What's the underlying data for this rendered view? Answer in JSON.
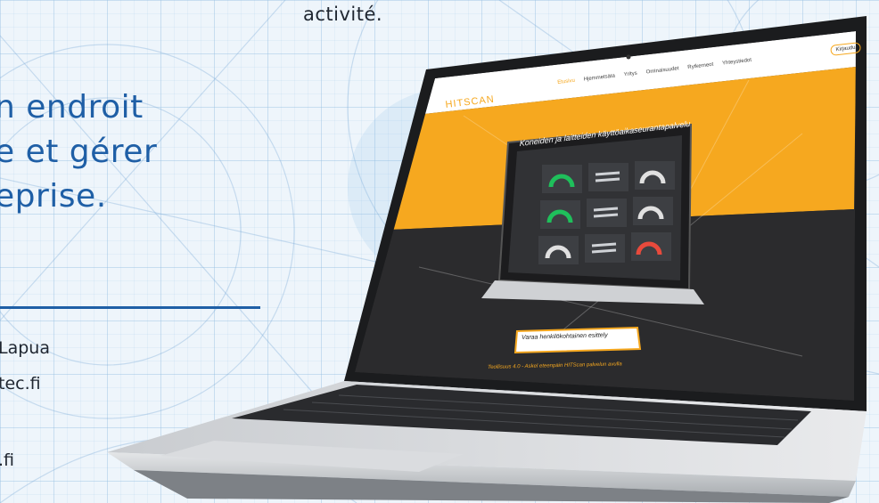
{
  "intro": {
    "tail": "activité."
  },
  "headline": {
    "line1": "n endroit",
    "line2": "e et gérer",
    "line3": "eprise."
  },
  "contact": {
    "line1": "Lapua",
    "line2": "tec.fi",
    "line3": ".fi"
  },
  "site": {
    "logo": "HITSCAN",
    "nav": [
      "Etusivu",
      "Hjemmetsäta",
      "Yritys",
      "Ominaisuudet",
      "Rytkerneot",
      "Yhteystiedot"
    ],
    "login": "Kirjaudu",
    "hero_title": "Koneiden ja laitteiden käyttöaikaseurantapalvelu",
    "cta": "Varaa henkilökohtainen esittely",
    "tagline": "Teollisuus 4.0 - Askel eteenpäin HITScan palvelun avulla"
  },
  "colors": {
    "brand_blue": "#1f5fa6",
    "hero_orange": "#f5a623",
    "dark": "#2b2b2d"
  }
}
